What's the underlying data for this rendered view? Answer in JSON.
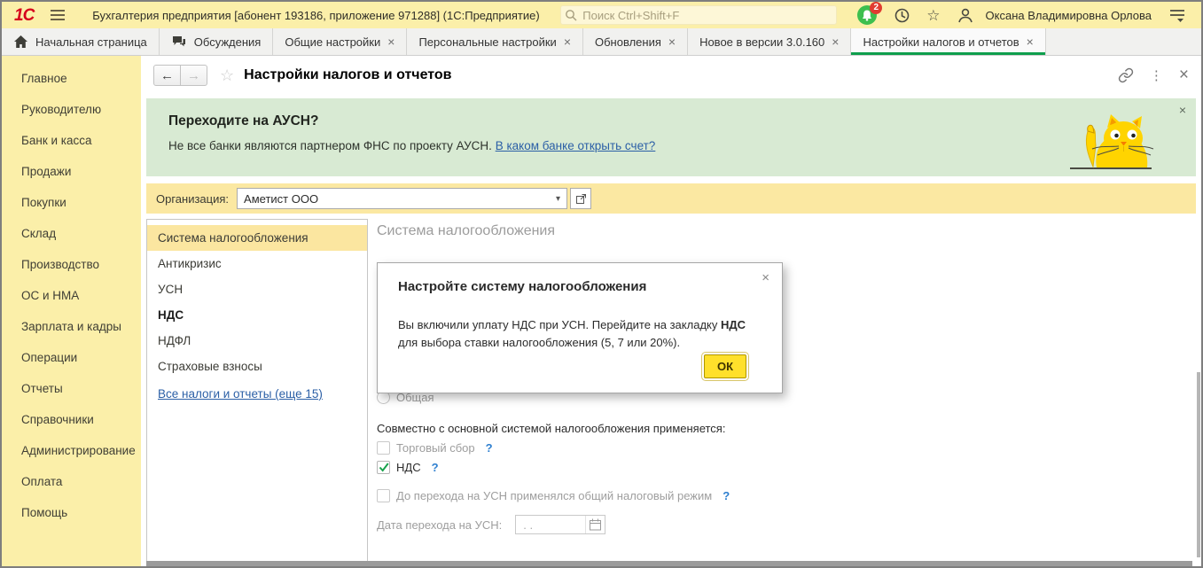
{
  "window": {
    "app_title": "Бухгалтерия предприятия [абонент 193186, приложение 971288] (1С:Предприятие)",
    "logo_text": "1С",
    "search_placeholder": "Поиск Ctrl+Shift+F",
    "notification_count": "2",
    "user_name": "Оксана Владимировна Орлова"
  },
  "icons": {
    "close": "×",
    "kebab": "⋮",
    "star_outline": "☆",
    "back": "←",
    "forward": "→",
    "dropdown": "▾",
    "help": "?"
  },
  "tabs": [
    {
      "label": "Начальная страница"
    },
    {
      "label": "Обсуждения"
    },
    {
      "label": "Общие настройки"
    },
    {
      "label": "Персональные настройки"
    },
    {
      "label": "Обновления"
    },
    {
      "label": "Новое в версии 3.0.160"
    },
    {
      "label": "Настройки налогов и отчетов"
    }
  ],
  "sidebar": {
    "items": [
      "Главное",
      "Руководителю",
      "Банк и касса",
      "Продажи",
      "Покупки",
      "Склад",
      "Производство",
      "ОС и НМА",
      "Зарплата и кадры",
      "Операции",
      "Отчеты",
      "Справочники",
      "Администрирование",
      "Оплата",
      "Помощь"
    ]
  },
  "page": {
    "title": "Настройки налогов и отчетов"
  },
  "banner": {
    "title": "Переходите на АУСН?",
    "text": "Не все банки являются партнером ФНС по проекту АУСН.",
    "link": "В каком банке открыть счет?"
  },
  "organization": {
    "label": "Организация:",
    "value": "Аметист ООО"
  },
  "settings_nav": {
    "items": [
      {
        "label": "Система налогообложения"
      },
      {
        "label": "Антикризис"
      },
      {
        "label": "УСН"
      },
      {
        "label": "НДС"
      },
      {
        "label": "НДФЛ"
      },
      {
        "label": "Страховые взносы"
      }
    ],
    "more_link": "Все налоги и отчеты (еще 15)"
  },
  "panel": {
    "title": "Система налогообложения",
    "radio_general": "Общая",
    "combined_label": "Совместно с основной системой налогообложения применяется:",
    "checkbox_trade": "Торговый сбор",
    "checkbox_vat": "НДС",
    "checkbox_before_usn": "До перехода на УСН применялся общий налоговый режим",
    "date_label": "Дата перехода на УСН:",
    "date_placeholder": ".  ."
  },
  "dialog": {
    "title": "Настройте систему налогообложения",
    "body_before": "Вы включили уплату НДС при УСН. Перейдите на закладку",
    "body_bold": "НДС",
    "body_after": "для выбора ставки налогообложения (5, 7 или 20%).",
    "ok_label": "ОК"
  },
  "colors": {
    "topbar_bg": "#FBEFA9",
    "banner_bg": "#D8EAD3",
    "accent_green": "#0E9E4D",
    "ok_button_bg": "#FFE02B",
    "link_blue": "#2B5FA6",
    "badge_red": "#E03C31",
    "check_green": "#18A24C",
    "selected_item_bg": "#FBE6A0"
  }
}
